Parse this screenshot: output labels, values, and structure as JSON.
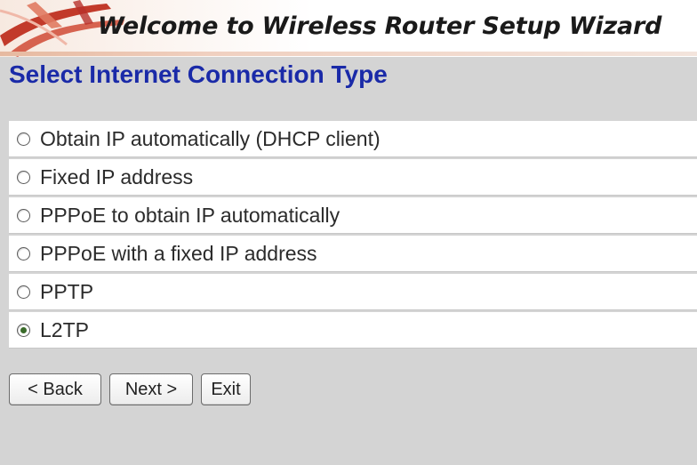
{
  "header": {
    "title": "Welcome to Wireless Router Setup Wizard",
    "logo_icon": "router-swoosh-logo"
  },
  "section": {
    "title": "Select Internet Connection Type"
  },
  "options": [
    {
      "label": "Obtain IP automatically (DHCP client)",
      "selected": false
    },
    {
      "label": "Fixed IP address",
      "selected": false
    },
    {
      "label": "PPPoE to obtain IP automatically",
      "selected": false
    },
    {
      "label": "PPPoE with a fixed IP address",
      "selected": false
    },
    {
      "label": "PPTP",
      "selected": false
    },
    {
      "label": "L2TP",
      "selected": true
    }
  ],
  "buttons": {
    "back_label": "< Back",
    "next_label": "Next >",
    "exit_label": "Exit"
  },
  "colors": {
    "heading": "#1a2aa8",
    "background": "#d4d4d4",
    "banner_accent": "#e6b9a0"
  }
}
